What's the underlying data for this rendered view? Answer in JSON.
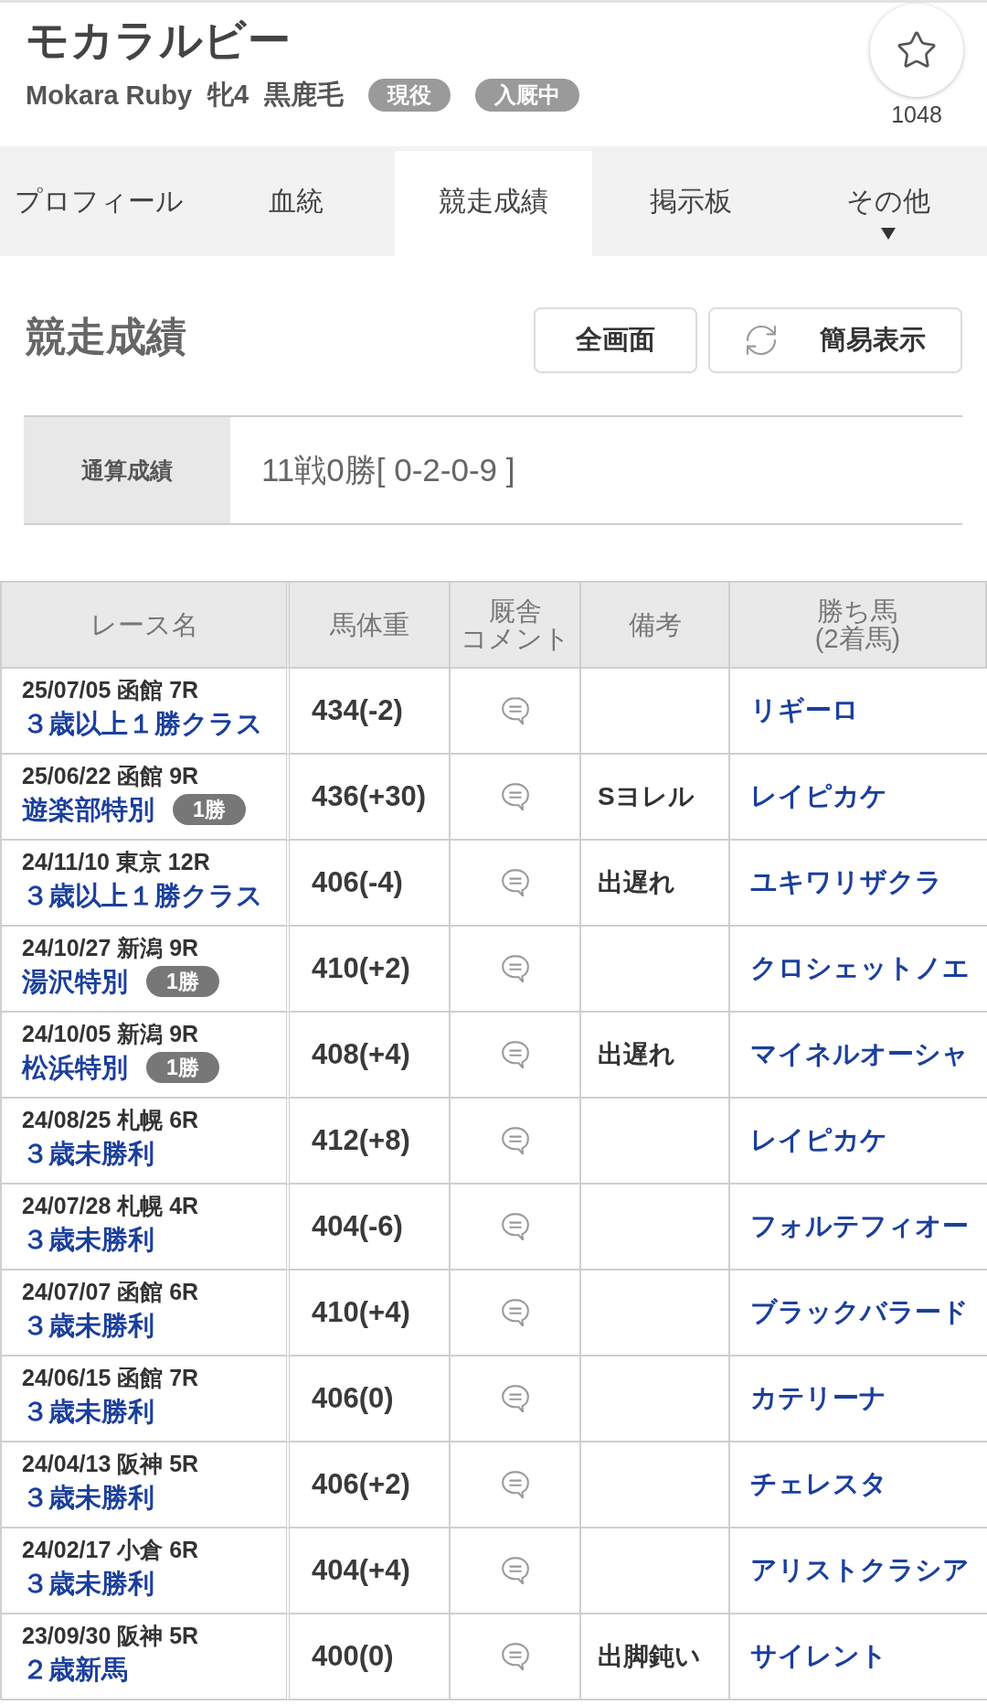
{
  "horse": {
    "name": "モカラルビー",
    "name_en": "Mokara Ruby",
    "sex_age": "牝4",
    "coat": "黒鹿毛",
    "badges": [
      "現役",
      "入厩中"
    ]
  },
  "favorite": {
    "count": "1048"
  },
  "tabs": [
    {
      "label": "プロフィール",
      "selected": false,
      "kind": "page"
    },
    {
      "label": "血統",
      "selected": false,
      "kind": "page"
    },
    {
      "label": "競走成績",
      "selected": true,
      "kind": "page"
    },
    {
      "label": "掲示板",
      "selected": false,
      "kind": "page"
    },
    {
      "label": "その他",
      "selected": false,
      "kind": "menu"
    }
  ],
  "section": {
    "title": "競走成績",
    "buttons": [
      {
        "label": "全画面",
        "kind": "plain"
      },
      {
        "label": "簡易表示",
        "kind": "refresh"
      }
    ]
  },
  "summary": {
    "label": "通算成績",
    "value": "11戦0勝[ 0-2-0-9 ]"
  },
  "table": {
    "columns": [
      {
        "lines": [
          "レース名"
        ]
      },
      {
        "lines": [
          "馬体重"
        ]
      },
      {
        "lines": [
          "厩舎",
          "コメント"
        ]
      },
      {
        "lines": [
          "備考"
        ]
      },
      {
        "lines": [
          "勝ち馬",
          "(2着馬)"
        ]
      }
    ],
    "rows": [
      {
        "date": "25/07/05 函館 7R",
        "race": "３歳以上１勝クラス",
        "weight": "434(-2)",
        "winner": "リギーロ"
      },
      {
        "date": "25/06/22 函館 9R",
        "race": "遊楽部特別",
        "grade": "1勝",
        "weight": "436(+30)",
        "note": "Sヨレル",
        "winner": "レイピカケ"
      },
      {
        "date": "24/11/10 東京 12R",
        "race": "３歳以上１勝クラス",
        "weight": "406(-4)",
        "note": "出遅れ",
        "winner": "ユキワリザクラ"
      },
      {
        "date": "24/10/27 新潟 9R",
        "race": "湯沢特別",
        "grade": "1勝",
        "weight": "410(+2)",
        "winner": "クロシェットノエ"
      },
      {
        "date": "24/10/05 新潟 9R",
        "race": "松浜特別",
        "grade": "1勝",
        "weight": "408(+4)",
        "note": "出遅れ",
        "winner": "マイネルオーシャ"
      },
      {
        "date": "24/08/25 札幌 6R",
        "race": "３歳未勝利",
        "weight": "412(+8)",
        "winner": "レイピカケ"
      },
      {
        "date": "24/07/28 札幌 4R",
        "race": "３歳未勝利",
        "weight": "404(-6)",
        "winner": "フォルテフィオー"
      },
      {
        "date": "24/07/07 函館 6R",
        "race": "３歳未勝利",
        "weight": "410(+4)",
        "winner": "ブラックバラード"
      },
      {
        "date": "24/06/15 函館 7R",
        "race": "３歳未勝利",
        "weight": "406(0)",
        "winner": "カテリーナ"
      },
      {
        "date": "24/04/13 阪神 5R",
        "race": "３歳未勝利",
        "weight": "406(+2)",
        "winner": "チェレスタ"
      },
      {
        "date": "24/02/17 小倉 6R",
        "race": "３歳未勝利",
        "weight": "404(+4)",
        "winner": "アリストクラシア"
      },
      {
        "date": "23/09/30 阪神 5R",
        "race": "２歳新馬",
        "weight": "400(0)",
        "note": "出脚鈍い",
        "winner": "サイレント"
      }
    ]
  }
}
